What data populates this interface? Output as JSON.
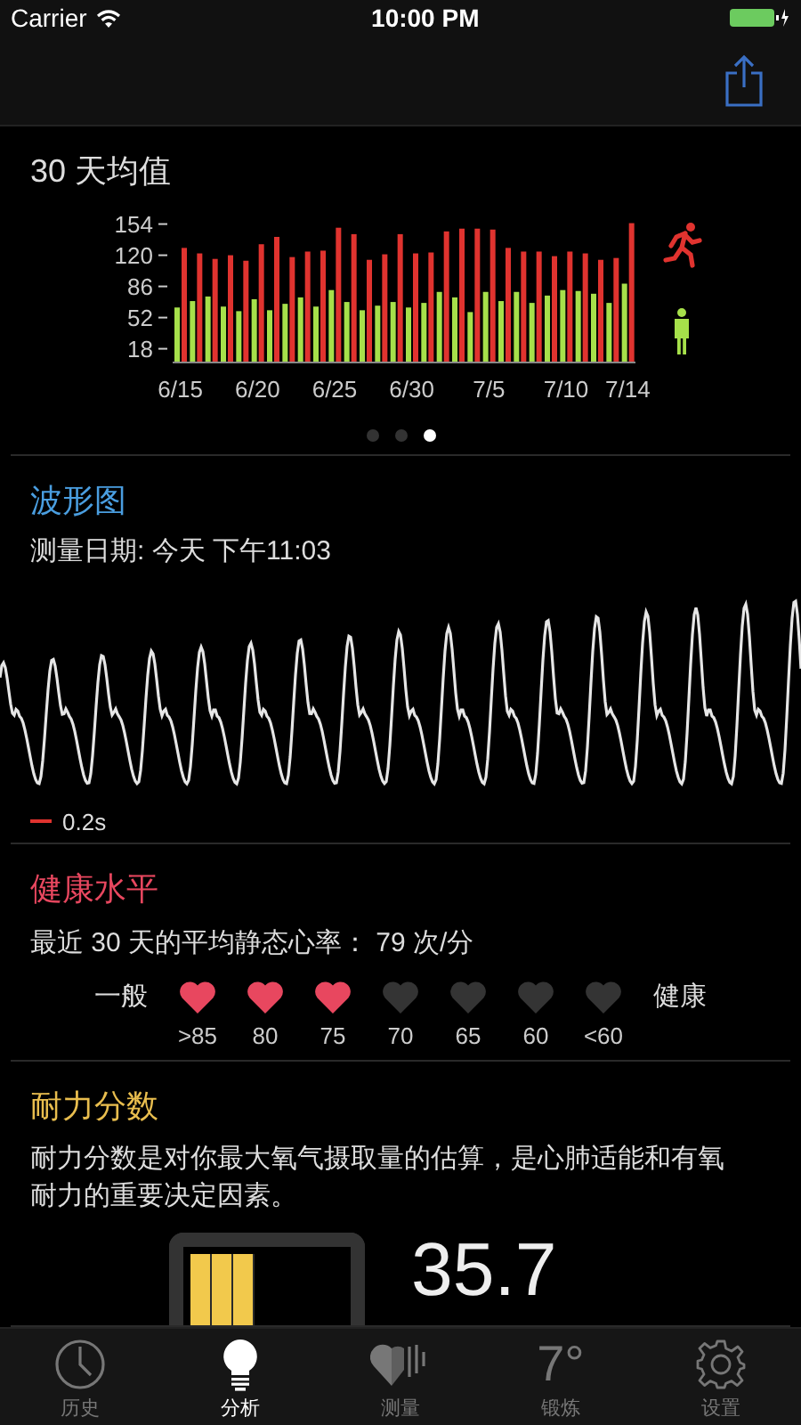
{
  "status_bar": {
    "carrier": "Carrier",
    "time": "10:00 PM"
  },
  "average_section": {
    "title": "30 天均值",
    "chart_data": {
      "type": "bar",
      "categories": [
        "6/15",
        null,
        null,
        null,
        null,
        "6/20",
        null,
        null,
        null,
        null,
        "6/25",
        null,
        null,
        null,
        null,
        "6/30",
        null,
        null,
        null,
        null,
        "7/5",
        null,
        null,
        null,
        null,
        "7/10",
        null,
        null,
        null,
        "7/14"
      ],
      "series": [
        {
          "color": "#a6e04a",
          "values": [
            63,
            70,
            75,
            64,
            59,
            72,
            60,
            67,
            74,
            64,
            82,
            69,
            60,
            65,
            69,
            63,
            68,
            80,
            74,
            58,
            80,
            70,
            80,
            68,
            76,
            82,
            81,
            78,
            68,
            89
          ]
        },
        {
          "color": "#e0332f",
          "values": [
            128,
            122,
            116,
            120,
            114,
            132,
            140,
            118,
            124,
            125,
            150,
            143,
            115,
            121,
            143,
            122,
            123,
            146,
            149,
            149,
            148,
            128,
            124,
            124,
            119,
            124,
            122,
            115,
            117,
            155
          ]
        }
      ],
      "ylim": [
        4,
        160
      ],
      "yticks": [
        18,
        52,
        86,
        120,
        154
      ]
    },
    "pages": [
      {
        "selected": false
      },
      {
        "selected": false
      },
      {
        "selected": true
      }
    ]
  },
  "waveform_section": {
    "title": "波形图",
    "date": "测量日期: 今天 下午11:03",
    "scale": "0.2s"
  },
  "health_section": {
    "title": "健康水平",
    "summary": "最近 30 天的平均静态心率： 79 次/分",
    "low_label": "一般",
    "high_label": "健康",
    "hearts": [
      {
        "label": ">85",
        "on": true
      },
      {
        "label": "80",
        "on": true
      },
      {
        "label": "75",
        "on": true
      },
      {
        "label": "70",
        "on": false
      },
      {
        "label": "65",
        "on": false
      },
      {
        "label": "60",
        "on": false
      },
      {
        "label": "<60",
        "on": false
      }
    ]
  },
  "endurance_section": {
    "title": "耐力分数",
    "description": "耐力分数是对你最大氧气摄取量的估算，是心肺适能和有氧耐力的重要决定因素。",
    "score": "35.7"
  },
  "tabs": [
    {
      "label": "历史",
      "kind": "clock",
      "selected": false
    },
    {
      "label": "分析",
      "kind": "bulb",
      "selected": true
    },
    {
      "label": "测量",
      "kind": "heart",
      "selected": false
    },
    {
      "label": "锻炼",
      "kind": "glyph",
      "glyph": "7°",
      "selected": false
    },
    {
      "label": "设置",
      "kind": "gear",
      "selected": false
    }
  ]
}
